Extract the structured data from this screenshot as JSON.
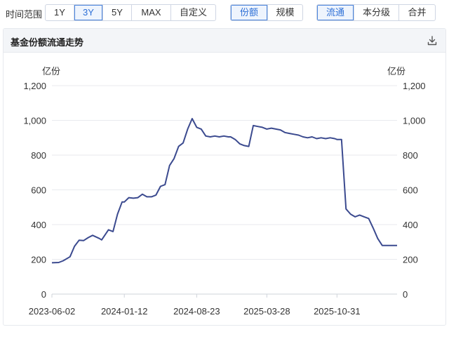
{
  "toolbar": {
    "range_label": "时间范围",
    "range_options": [
      "1Y",
      "3Y",
      "5Y",
      "MAX",
      "自定义"
    ],
    "range_selected": "3Y",
    "metric_options": [
      "份额",
      "规模"
    ],
    "metric_selected": "份额",
    "share_type_options": [
      "流通",
      "本分级",
      "合并"
    ],
    "share_type_selected": "流通"
  },
  "panel": {
    "title": "基金份额流通走势",
    "download_icon": "download-icon"
  },
  "colors": {
    "line": "#3b4a8f",
    "accent": "#2d6fd6",
    "grid": "#e8eaee"
  },
  "chart_data": {
    "type": "line",
    "ylabel_left": "亿份",
    "ylabel_right": "亿份",
    "ylim": [
      0,
      1200
    ],
    "y_ticks": [
      "0",
      "200",
      "400",
      "600",
      "800",
      "1,000",
      "1,200"
    ],
    "y_tick_values": [
      0,
      200,
      400,
      600,
      800,
      1000,
      1200
    ],
    "x_ticks": [
      "2023-06-02",
      "2024-01-12",
      "2024-08-23",
      "2025-03-28",
      "2025-10-31"
    ],
    "xlim": [
      "2023-06-02",
      "2026-05-05"
    ],
    "grid": true,
    "series": [
      {
        "x": [
          "2023-06-02",
          "2023-06-23",
          "2023-07-07",
          "2023-07-28",
          "2023-08-11",
          "2023-08-25",
          "2023-09-08",
          "2023-09-22",
          "2023-10-06",
          "2023-10-27",
          "2023-11-03",
          "2023-11-24",
          "2023-12-08",
          "2023-12-22",
          "2024-01-05",
          "2024-01-12",
          "2024-01-26",
          "2024-02-09",
          "2024-02-23",
          "2024-03-08",
          "2024-03-22",
          "2024-04-05",
          "2024-04-19",
          "2024-05-03",
          "2024-05-17",
          "2024-05-31",
          "2024-06-14",
          "2024-06-28",
          "2024-07-12",
          "2024-07-26",
          "2024-08-09",
          "2024-08-23",
          "2024-09-06",
          "2024-09-20",
          "2024-10-04",
          "2024-10-18",
          "2024-11-01",
          "2024-11-15",
          "2024-11-29",
          "2024-12-06",
          "2024-12-20",
          "2025-01-03",
          "2025-01-17",
          "2025-01-31",
          "2025-02-14",
          "2025-02-28",
          "2025-03-14",
          "2025-03-28",
          "2025-04-11",
          "2025-04-25",
          "2025-05-09",
          "2025-05-23",
          "2025-06-06",
          "2025-06-20",
          "2025-07-04",
          "2025-07-18",
          "2025-08-01",
          "2025-08-15",
          "2025-08-29",
          "2025-09-12",
          "2025-09-26",
          "2025-10-10",
          "2025-10-24",
          "2025-10-31",
          "2025-11-14",
          "2025-11-28",
          "2025-12-12",
          "2025-12-26",
          "2026-01-09",
          "2026-01-23",
          "2026-02-06",
          "2026-02-20",
          "2026-03-06",
          "2026-03-20",
          "2026-04-03",
          "2026-04-17",
          "2026-05-05"
        ],
        "y": [
          180,
          182,
          192,
          215,
          275,
          310,
          308,
          325,
          338,
          320,
          312,
          370,
          360,
          460,
          530,
          530,
          555,
          552,
          555,
          575,
          560,
          560,
          570,
          620,
          630,
          740,
          780,
          850,
          870,
          950,
          1010,
          960,
          950,
          910,
          905,
          910,
          905,
          910,
          905,
          905,
          890,
          865,
          855,
          850,
          970,
          965,
          960,
          950,
          955,
          950,
          945,
          930,
          925,
          920,
          915,
          905,
          900,
          905,
          895,
          900,
          895,
          900,
          895,
          890,
          890,
          490,
          460,
          445,
          455,
          445,
          435,
          380,
          320,
          280,
          280,
          280,
          280
        ]
      }
    ]
  }
}
